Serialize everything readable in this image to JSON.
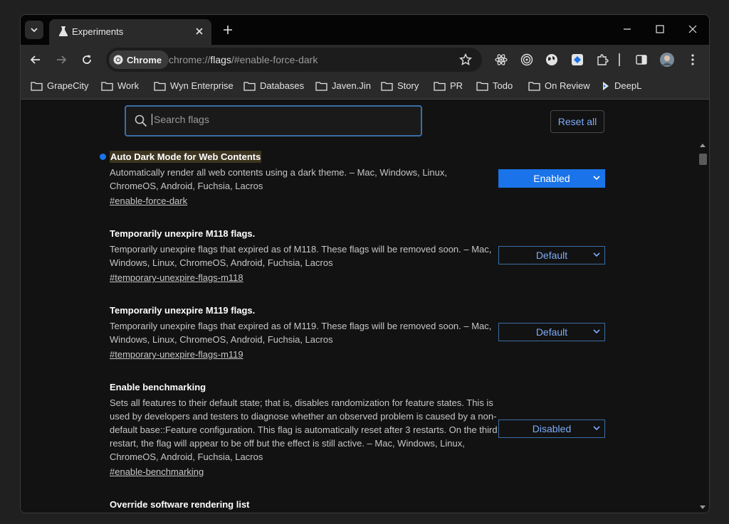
{
  "tab": {
    "title": "Experiments"
  },
  "omnibox": {
    "chip": "Chrome",
    "url_scheme": "chrome://",
    "url_host": "flags",
    "url_path": "/#enable-force-dark"
  },
  "bookmarks": [
    "GrapeCity",
    "Work",
    "Wyn Enterprise",
    "Databases",
    "Javen.Jin",
    "Story",
    "PR",
    "Todo",
    "On Review",
    "DeepL"
  ],
  "search": {
    "placeholder": "Search flags"
  },
  "reset_label": "Reset all",
  "flags": [
    {
      "title": "Auto Dark Mode for Web Contents",
      "desc": "Automatically render all web contents using a dark theme. – Mac, Windows, Linux, ChromeOS, Android, Fuchsia, Lacros",
      "link": "#enable-force-dark",
      "value": "Enabled"
    },
    {
      "title": "Temporarily unexpire M118 flags.",
      "desc": "Temporarily unexpire flags that expired as of M118. These flags will be removed soon. – Mac, Windows, Linux, ChromeOS, Android, Fuchsia, Lacros",
      "link": "#temporary-unexpire-flags-m118",
      "value": "Default"
    },
    {
      "title": "Temporarily unexpire M119 flags.",
      "desc": "Temporarily unexpire flags that expired as of M119. These flags will be removed soon. – Mac, Windows, Linux, ChromeOS, Android, Fuchsia, Lacros",
      "link": "#temporary-unexpire-flags-m119",
      "value": "Default"
    },
    {
      "title": "Enable benchmarking",
      "desc": "Sets all features to their default state; that is, disables randomization for feature states. This is used by developers and testers to diagnose whether an observed problem is caused by a non-default base::Feature configuration. This flag is automatically reset after 3 restarts. On the third restart, the flag will appear to be off but the effect is still active. – Mac, Windows, Linux, ChromeOS, Android, Fuchsia, Lacros",
      "link": "#enable-benchmarking",
      "value": "Disabled"
    },
    {
      "title": "Override software rendering list"
    }
  ]
}
